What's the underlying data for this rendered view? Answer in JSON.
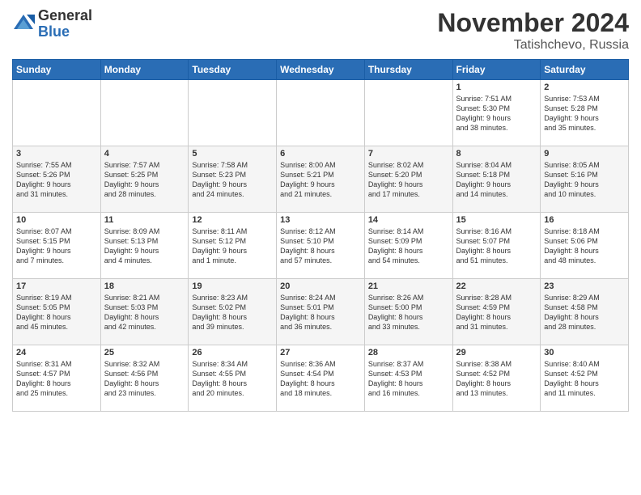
{
  "header": {
    "logo": {
      "general": "General",
      "blue": "Blue"
    },
    "title": "November 2024",
    "location": "Tatishchevo, Russia"
  },
  "weekdays": [
    "Sunday",
    "Monday",
    "Tuesday",
    "Wednesday",
    "Thursday",
    "Friday",
    "Saturday"
  ],
  "weeks": [
    [
      {
        "day": "",
        "info": ""
      },
      {
        "day": "",
        "info": ""
      },
      {
        "day": "",
        "info": ""
      },
      {
        "day": "",
        "info": ""
      },
      {
        "day": "",
        "info": ""
      },
      {
        "day": "1",
        "info": "Sunrise: 7:51 AM\nSunset: 5:30 PM\nDaylight: 9 hours\nand 38 minutes."
      },
      {
        "day": "2",
        "info": "Sunrise: 7:53 AM\nSunset: 5:28 PM\nDaylight: 9 hours\nand 35 minutes."
      }
    ],
    [
      {
        "day": "3",
        "info": "Sunrise: 7:55 AM\nSunset: 5:26 PM\nDaylight: 9 hours\nand 31 minutes."
      },
      {
        "day": "4",
        "info": "Sunrise: 7:57 AM\nSunset: 5:25 PM\nDaylight: 9 hours\nand 28 minutes."
      },
      {
        "day": "5",
        "info": "Sunrise: 7:58 AM\nSunset: 5:23 PM\nDaylight: 9 hours\nand 24 minutes."
      },
      {
        "day": "6",
        "info": "Sunrise: 8:00 AM\nSunset: 5:21 PM\nDaylight: 9 hours\nand 21 minutes."
      },
      {
        "day": "7",
        "info": "Sunrise: 8:02 AM\nSunset: 5:20 PM\nDaylight: 9 hours\nand 17 minutes."
      },
      {
        "day": "8",
        "info": "Sunrise: 8:04 AM\nSunset: 5:18 PM\nDaylight: 9 hours\nand 14 minutes."
      },
      {
        "day": "9",
        "info": "Sunrise: 8:05 AM\nSunset: 5:16 PM\nDaylight: 9 hours\nand 10 minutes."
      }
    ],
    [
      {
        "day": "10",
        "info": "Sunrise: 8:07 AM\nSunset: 5:15 PM\nDaylight: 9 hours\nand 7 minutes."
      },
      {
        "day": "11",
        "info": "Sunrise: 8:09 AM\nSunset: 5:13 PM\nDaylight: 9 hours\nand 4 minutes."
      },
      {
        "day": "12",
        "info": "Sunrise: 8:11 AM\nSunset: 5:12 PM\nDaylight: 9 hours\nand 1 minute."
      },
      {
        "day": "13",
        "info": "Sunrise: 8:12 AM\nSunset: 5:10 PM\nDaylight: 8 hours\nand 57 minutes."
      },
      {
        "day": "14",
        "info": "Sunrise: 8:14 AM\nSunset: 5:09 PM\nDaylight: 8 hours\nand 54 minutes."
      },
      {
        "day": "15",
        "info": "Sunrise: 8:16 AM\nSunset: 5:07 PM\nDaylight: 8 hours\nand 51 minutes."
      },
      {
        "day": "16",
        "info": "Sunrise: 8:18 AM\nSunset: 5:06 PM\nDaylight: 8 hours\nand 48 minutes."
      }
    ],
    [
      {
        "day": "17",
        "info": "Sunrise: 8:19 AM\nSunset: 5:05 PM\nDaylight: 8 hours\nand 45 minutes."
      },
      {
        "day": "18",
        "info": "Sunrise: 8:21 AM\nSunset: 5:03 PM\nDaylight: 8 hours\nand 42 minutes."
      },
      {
        "day": "19",
        "info": "Sunrise: 8:23 AM\nSunset: 5:02 PM\nDaylight: 8 hours\nand 39 minutes."
      },
      {
        "day": "20",
        "info": "Sunrise: 8:24 AM\nSunset: 5:01 PM\nDaylight: 8 hours\nand 36 minutes."
      },
      {
        "day": "21",
        "info": "Sunrise: 8:26 AM\nSunset: 5:00 PM\nDaylight: 8 hours\nand 33 minutes."
      },
      {
        "day": "22",
        "info": "Sunrise: 8:28 AM\nSunset: 4:59 PM\nDaylight: 8 hours\nand 31 minutes."
      },
      {
        "day": "23",
        "info": "Sunrise: 8:29 AM\nSunset: 4:58 PM\nDaylight: 8 hours\nand 28 minutes."
      }
    ],
    [
      {
        "day": "24",
        "info": "Sunrise: 8:31 AM\nSunset: 4:57 PM\nDaylight: 8 hours\nand 25 minutes."
      },
      {
        "day": "25",
        "info": "Sunrise: 8:32 AM\nSunset: 4:56 PM\nDaylight: 8 hours\nand 23 minutes."
      },
      {
        "day": "26",
        "info": "Sunrise: 8:34 AM\nSunset: 4:55 PM\nDaylight: 8 hours\nand 20 minutes."
      },
      {
        "day": "27",
        "info": "Sunrise: 8:36 AM\nSunset: 4:54 PM\nDaylight: 8 hours\nand 18 minutes."
      },
      {
        "day": "28",
        "info": "Sunrise: 8:37 AM\nSunset: 4:53 PM\nDaylight: 8 hours\nand 16 minutes."
      },
      {
        "day": "29",
        "info": "Sunrise: 8:38 AM\nSunset: 4:52 PM\nDaylight: 8 hours\nand 13 minutes."
      },
      {
        "day": "30",
        "info": "Sunrise: 8:40 AM\nSunset: 4:52 PM\nDaylight: 8 hours\nand 11 minutes."
      }
    ]
  ]
}
